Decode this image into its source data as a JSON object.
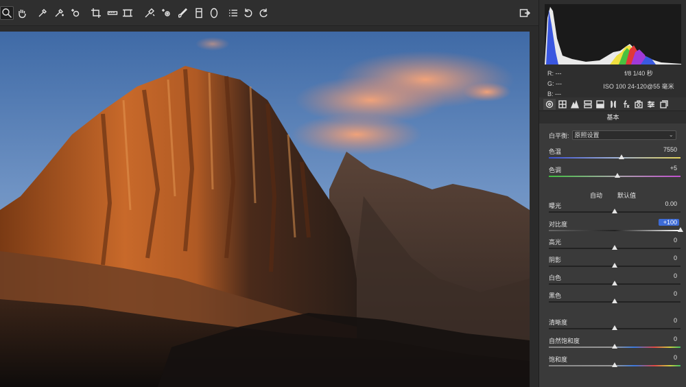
{
  "toolbar": {
    "tools": [
      "zoom-tool",
      "hand-tool",
      "white-balance-tool",
      "color-sampler-tool",
      "targeted-adjustment-tool",
      "crop-tool",
      "straighten-tool",
      "transform-tool",
      "spot-removal-tool",
      "red-eye-tool",
      "adjustment-brush-tool",
      "graduated-filter-tool",
      "radial-filter-tool",
      "preferences-tool",
      "rotate-ccw-tool",
      "rotate-cw-tool"
    ],
    "active_tool": "zoom-tool",
    "export_icon": "export-icon"
  },
  "histogram": {
    "rgb": {
      "r": "R:  ---",
      "g": "G:  ---",
      "b": "B:  ---"
    },
    "exif": {
      "aperture_shutter": "f/8   1/40 秒",
      "iso_lens": "ISO 100   24-120@55 毫米"
    }
  },
  "panel": {
    "section_title": "基本",
    "tabs": [
      "basic-tab",
      "tone-curve-tab",
      "detail-tab",
      "hsl-tab",
      "split-toning-tab",
      "lens-corrections-tab",
      "effects-tab",
      "camera-calibration-tab",
      "presets-tab",
      "snapshots-tab"
    ],
    "white_balance": {
      "label": "白平衡:",
      "value": "原照设置"
    },
    "links": {
      "auto": "自动",
      "default": "默认值"
    },
    "sliders": {
      "temp": {
        "label": "色温",
        "value": "7550",
        "level": 0.55
      },
      "tint": {
        "label": "色调",
        "value": "+5",
        "level": 0.52
      },
      "exposure": {
        "label": "曝光",
        "value": "0.00",
        "level": 0.5
      },
      "contrast": {
        "label": "对比度",
        "value": "+100",
        "level": 1.0
      },
      "highlights": {
        "label": "高光",
        "value": "0",
        "level": 0.5
      },
      "shadows": {
        "label": "阴影",
        "value": "0",
        "level": 0.5
      },
      "whites": {
        "label": "白色",
        "value": "0",
        "level": 0.5
      },
      "blacks": {
        "label": "黑色",
        "value": "0",
        "level": 0.5
      },
      "clarity": {
        "label": "清晰度",
        "value": "0",
        "level": 0.5
      },
      "vibrance": {
        "label": "自然饱和度",
        "value": "0",
        "level": 0.5
      },
      "saturation": {
        "label": "饱和度",
        "value": "0",
        "level": 0.5
      }
    }
  }
}
